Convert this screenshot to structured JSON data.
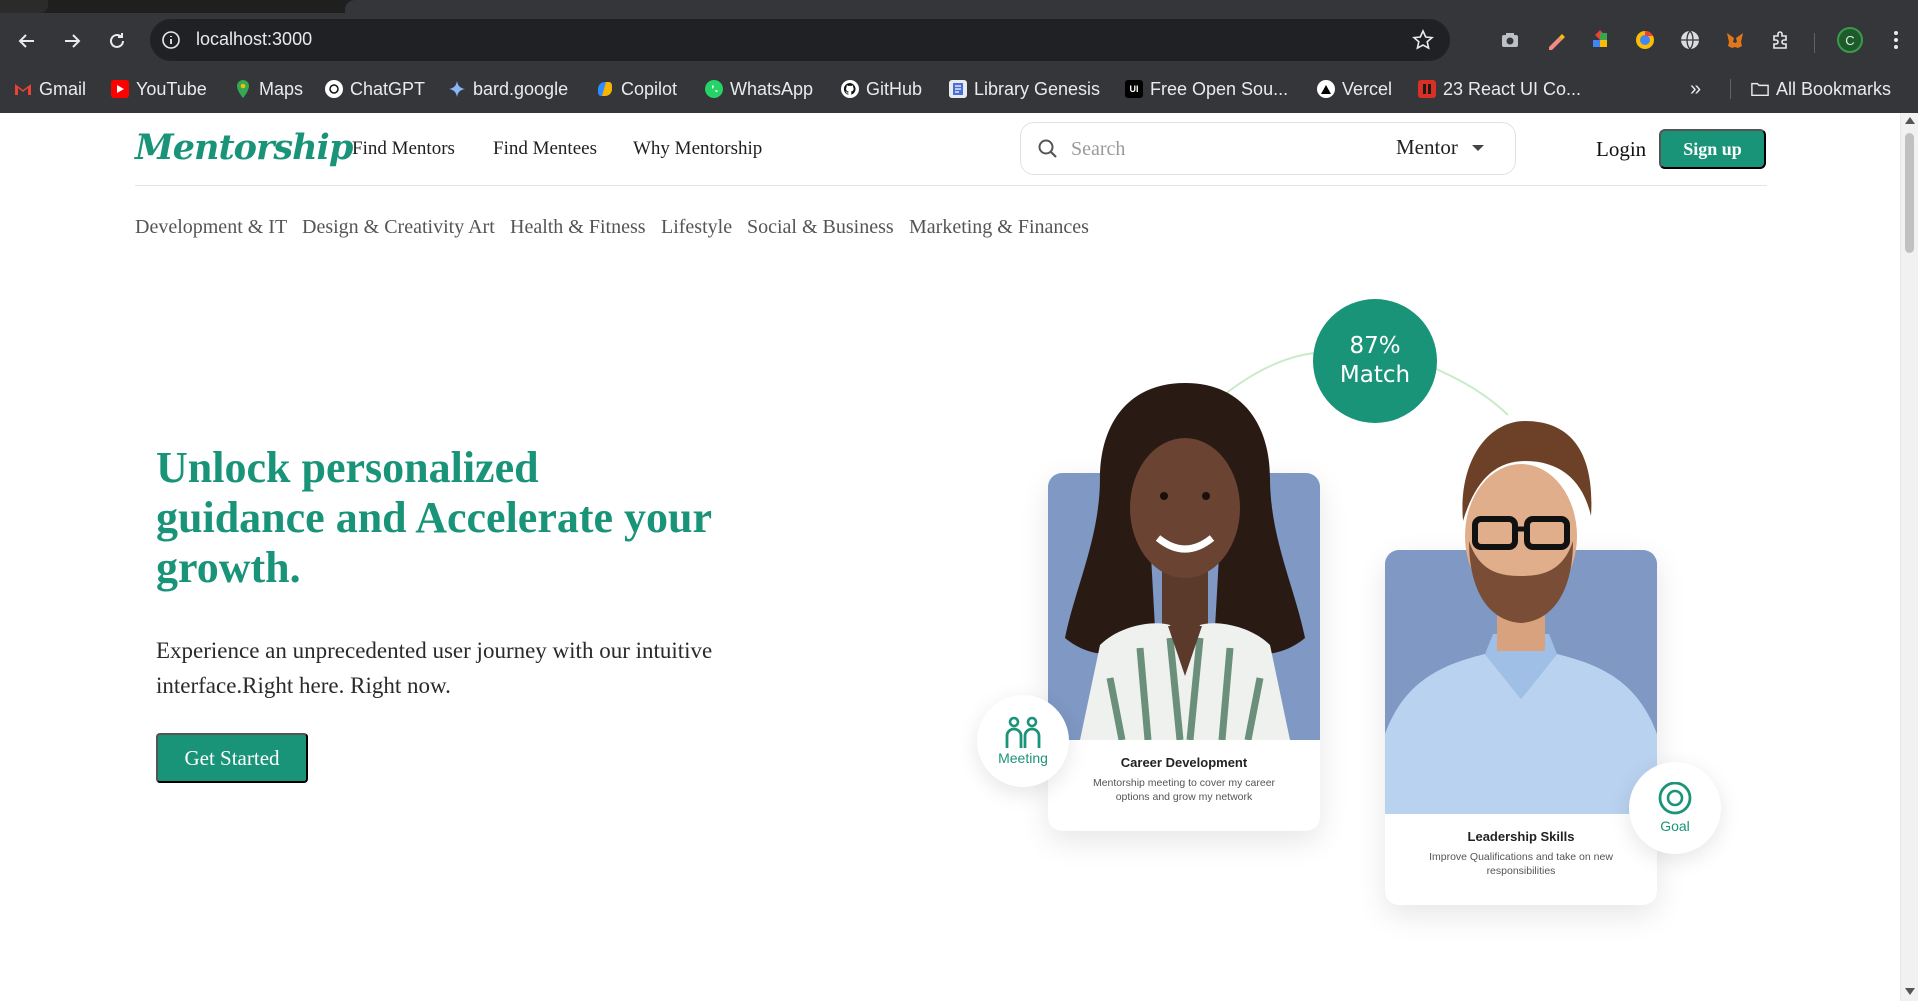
{
  "browser": {
    "url": "localhost:3000",
    "bookmarks": [
      {
        "label": "Gmail",
        "icon": "gmail-icon",
        "color": "#ea4335"
      },
      {
        "label": "YouTube",
        "icon": "youtube-icon",
        "color": "#ff0000"
      },
      {
        "label": "Maps",
        "icon": "maps-icon",
        "color": "#34a853"
      },
      {
        "label": "ChatGPT",
        "icon": "chatgpt-icon",
        "color": "#ffffff"
      },
      {
        "label": "bard.google",
        "icon": "bard-icon",
        "color": "#4285f4"
      },
      {
        "label": "Copilot",
        "icon": "copilot-icon",
        "color": "#7b61ff"
      },
      {
        "label": "WhatsApp",
        "icon": "whatsapp-icon",
        "color": "#25d366"
      },
      {
        "label": "GitHub",
        "icon": "github-icon",
        "color": "#ffffff"
      },
      {
        "label": "Library Genesis",
        "icon": "libgen-icon",
        "color": "#4a6fd8"
      },
      {
        "label": "Free Open Sou...",
        "icon": "ui-icon",
        "color": "#000000"
      },
      {
        "label": "Vercel",
        "icon": "vercel-icon",
        "color": "#ffffff"
      },
      {
        "label": "23 React UI Co...",
        "icon": "react-ui-icon",
        "color": "#d93025"
      }
    ],
    "all_bookmarks": "All Bookmarks",
    "profile_initial": "C"
  },
  "site": {
    "logo": "Mentorship",
    "nav": [
      "Find Mentors",
      "Find Mentees",
      "Why Mentorship"
    ],
    "search": {
      "placeholder": "Search",
      "role": "Mentor"
    },
    "login": "Login",
    "signup": "Sign up",
    "categories": [
      "Development & IT",
      "Design & Creativity Art",
      "Health & Fitness",
      "Lifestyle",
      "Social & Business",
      "Marketing & Finances"
    ],
    "brand_color": "#1a9479"
  },
  "hero": {
    "title": "Unlock personalized guidance and Accelerate your growth.",
    "subtitle": "Experience an unprecedented user journey with our intuitive interface.Right here. Right now.",
    "cta": "Get Started"
  },
  "illustration": {
    "match": {
      "percent": "87%",
      "label": "Match"
    },
    "mentor_card": {
      "title": "Career Development",
      "desc": "Mentorship meeting to cover my career options and grow my network"
    },
    "mentee_card": {
      "title": "Leadership Skills",
      "desc": "Improve Qualifications and take on new responsibilities"
    },
    "meeting_badge": "Meeting",
    "goal_badge": "Goal"
  }
}
